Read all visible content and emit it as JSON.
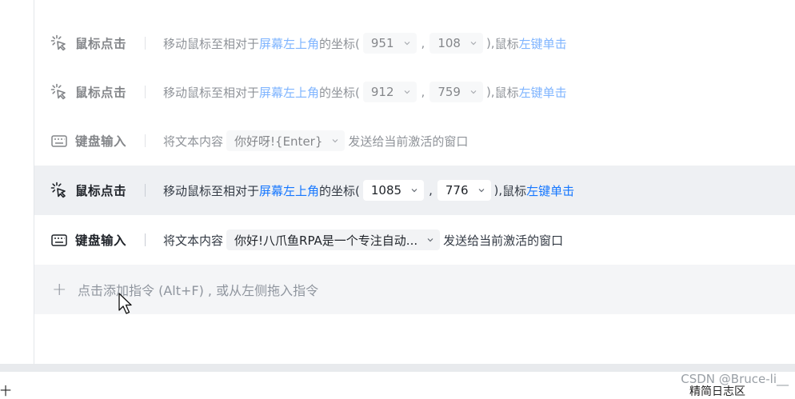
{
  "rows": [
    {
      "name": "鼠标点击",
      "icon": "mouse-click-icon",
      "state": "disabled",
      "desc_prefix": "移动鼠标至相对于",
      "anchor": "屏幕左上角",
      "desc_mid": "的坐标(",
      "x": "951",
      "y": "108",
      "desc_close": "),",
      "mouse_label": "鼠标",
      "action": "左键单击"
    },
    {
      "name": "鼠标点击",
      "icon": "mouse-click-icon",
      "state": "disabled",
      "desc_prefix": "移动鼠标至相对于",
      "anchor": "屏幕左上角",
      "desc_mid": "的坐标(",
      "x": "912",
      "y": "759",
      "desc_close": "),",
      "mouse_label": "鼠标",
      "action": "左键单击"
    },
    {
      "name": "键盘输入",
      "icon": "keyboard-icon",
      "state": "disabled",
      "desc_prefix": "将文本内容",
      "text": "你好呀!{Enter}",
      "desc_suffix": "发送给当前激活的窗口"
    },
    {
      "name": "鼠标点击",
      "icon": "mouse-click-icon",
      "state": "selected",
      "desc_prefix": "移动鼠标至相对于",
      "anchor": "屏幕左上角",
      "desc_mid": "的坐标(",
      "x": "1085",
      "y": "776",
      "desc_close": "),",
      "mouse_label": "鼠标",
      "action": "左键单击"
    },
    {
      "name": "键盘输入",
      "icon": "keyboard-icon",
      "state": "enabled",
      "desc_prefix": "将文本内容",
      "text": "你好!八爪鱼RPA是一个专注自动...",
      "desc_suffix": "发送给当前激活的窗口"
    }
  ],
  "comma": ",",
  "add_instruction": {
    "plus": "+",
    "label": "点击添加指令 (Alt+F) , 或从左侧拖入指令"
  },
  "watermark": "CSDN @Bruce-li__",
  "footer": {
    "left": "十",
    "right": "精简日志区"
  },
  "colors": {
    "accent": "#1677ff",
    "selected_row": "#eef0f3",
    "add_row": "#f4f5f7"
  }
}
